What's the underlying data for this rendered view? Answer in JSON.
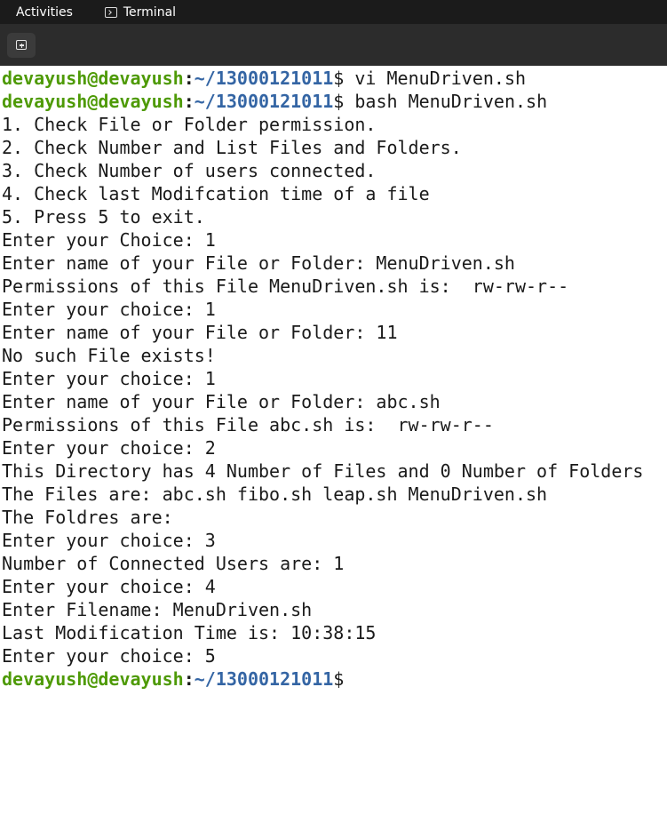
{
  "topbar": {
    "activities_label": "Activities",
    "app_label": "Terminal"
  },
  "headerbar": {
    "new_tab_icon": "new-tab-icon"
  },
  "terminal": {
    "prompt": {
      "user_host": "devayush@devayush",
      "colon": ":",
      "path": "~/13000121011",
      "symbol": "$"
    },
    "lines": [
      {
        "type": "prompt",
        "cmd": " vi MenuDriven.sh"
      },
      {
        "type": "prompt",
        "cmd": " bash MenuDriven.sh"
      },
      {
        "type": "output",
        "text": "1. Check File or Folder permission."
      },
      {
        "type": "output",
        "text": "2. Check Number and List Files and Folders."
      },
      {
        "type": "output",
        "text": "3. Check Number of users connected."
      },
      {
        "type": "output",
        "text": "4. Check last Modifcation time of a file"
      },
      {
        "type": "output",
        "text": "5. Press 5 to exit."
      },
      {
        "type": "output",
        "text": "Enter your Choice: 1"
      },
      {
        "type": "output",
        "text": "Enter name of your File or Folder: MenuDriven.sh"
      },
      {
        "type": "output",
        "text": "Permissions of this File MenuDriven.sh is:  rw-rw-r--"
      },
      {
        "type": "output",
        "text": "Enter your choice: 1"
      },
      {
        "type": "output",
        "text": "Enter name of your File or Folder: 11"
      },
      {
        "type": "output",
        "text": "No such File exists!"
      },
      {
        "type": "output",
        "text": "Enter your choice: 1"
      },
      {
        "type": "output",
        "text": "Enter name of your File or Folder: abc.sh"
      },
      {
        "type": "output",
        "text": "Permissions of this File abc.sh is:  rw-rw-r--"
      },
      {
        "type": "output",
        "text": "Enter your choice: 2"
      },
      {
        "type": "output",
        "text": "This Directory has 4 Number of Files and 0 Number of Folders"
      },
      {
        "type": "output",
        "text": "The Files are: abc.sh fibo.sh leap.sh MenuDriven.sh"
      },
      {
        "type": "output",
        "text": "The Foldres are:"
      },
      {
        "type": "output",
        "text": "Enter your choice: 3"
      },
      {
        "type": "output",
        "text": "Number of Connected Users are: 1"
      },
      {
        "type": "output",
        "text": "Enter your choice: 4"
      },
      {
        "type": "output",
        "text": "Enter Filename: MenuDriven.sh"
      },
      {
        "type": "output",
        "text": "Last Modification Time is: 10:38:15"
      },
      {
        "type": "output",
        "text": "Enter your choice: 5"
      },
      {
        "type": "prompt",
        "cmd": ""
      }
    ]
  }
}
